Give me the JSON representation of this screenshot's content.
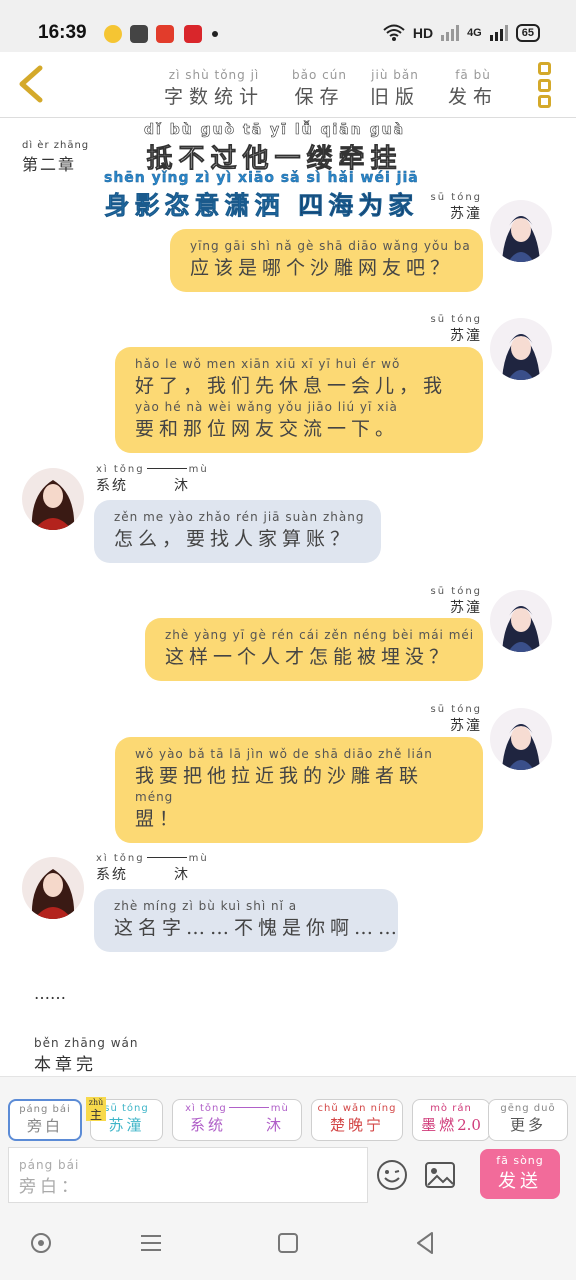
{
  "status_bar": {
    "time": "16:39",
    "notification_icons": [
      "bulb-icon",
      "paw-icon",
      "weibo-icon",
      "news-icon"
    ],
    "network": "HD",
    "signal_label": "4G",
    "battery": "65"
  },
  "nav": {
    "items": [
      {
        "py": "zì shù tǒng jì",
        "hz": "字数统计"
      },
      {
        "py": "bǎo cún",
        "hz": "保存"
      },
      {
        "py": "jiù bǎn",
        "hz": "旧版"
      },
      {
        "py": "fā bù",
        "hz": "发布"
      }
    ]
  },
  "chapter": {
    "label_py": "dì èr zhāng",
    "label_hz": "第二章",
    "title1_py": "dǐ bù guò tā yī lǚ qiān guà",
    "title1_hz": "抵不过他一缕牵挂",
    "title2_py": "shēn yǐng zì yì xiāo sǎ sì hǎi wéi jiā",
    "title2_hz_a": "身影恣意潇洒",
    "title2_hz_b": "四海为家"
  },
  "characters": {
    "sutong": {
      "py": "sū tóng",
      "hz": "苏潼"
    },
    "system": {
      "py_a": "xì tǒng",
      "py_b": "mù",
      "hz_a": "系统",
      "hz_b": "沐"
    }
  },
  "messages": [
    {
      "lines": [
        {
          "py": "yīng gāi shì nǎ gè shā diāo wǎng yǒu ba",
          "hz": "应该是哪个沙雕网友吧？"
        }
      ]
    },
    {
      "lines": [
        {
          "py": "hǎo le   wǒ men xiān xiū xī yī huì ér   wǒ",
          "hz": "好了，我们先休息一会儿，我"
        },
        {
          "py": "yào hé nà wèi wǎng yǒu jiāo liú yī xià",
          "hz": "要和那位网友交流一下。"
        }
      ]
    },
    {
      "lines": [
        {
          "py": "zěn me   yào zhǎo rén jiā suàn zhàng",
          "hz": "怎么，要找人家算账？"
        }
      ]
    },
    {
      "lines": [
        {
          "py": "zhè yàng yī gè rén cái zěn néng bèi mái méi",
          "hz": "这样一个人才怎能被埋没？"
        }
      ]
    },
    {
      "lines": [
        {
          "py": "wǒ yào bǎ tā lā jìn wǒ de shā diāo zhě lián",
          "hz": "我要把他拉近我的沙雕者联"
        },
        {
          "py": "méng",
          "hz": "盟！"
        }
      ]
    },
    {
      "lines": [
        {
          "py": "zhè míng zì   bù kuì shì nǐ a",
          "hz": "这名字……不愧是你啊……"
        }
      ]
    }
  ],
  "ellipsis": "……",
  "chapter_end": {
    "py": "běn zhāng wán",
    "hz": "本章完"
  },
  "roles": [
    {
      "py": "páng bái",
      "hz": "旁白",
      "color": "#888888"
    },
    {
      "py": "sū tóng",
      "hz": "苏潼",
      "color": "#3fb5c8",
      "badge": "主",
      "badge_py": "zhǔ"
    },
    {
      "py_a": "xì tǒng",
      "py_b": "mù",
      "hz_a": "系统",
      "hz_b": "沐",
      "color": "#b060c8"
    },
    {
      "py": "chǔ wǎn níng",
      "hz": "楚晚宁",
      "color": "#d34747"
    },
    {
      "py": "mò rán",
      "hz": "墨燃",
      "extra": "2.0",
      "color": "#d03c7a"
    },
    {
      "py": "gēng duō",
      "hz": "更多",
      "color": "#555555"
    }
  ],
  "input": {
    "py": "páng bái",
    "hz": "旁白："
  },
  "send": {
    "py": "fā sòng",
    "hz": "发送"
  },
  "colors": {
    "accent": "#d4a92a",
    "bubble_user": "#fcd974",
    "bubble_system": "#dfe5ef",
    "send": "#f26b9a",
    "title_blue": "#2a86c9"
  }
}
